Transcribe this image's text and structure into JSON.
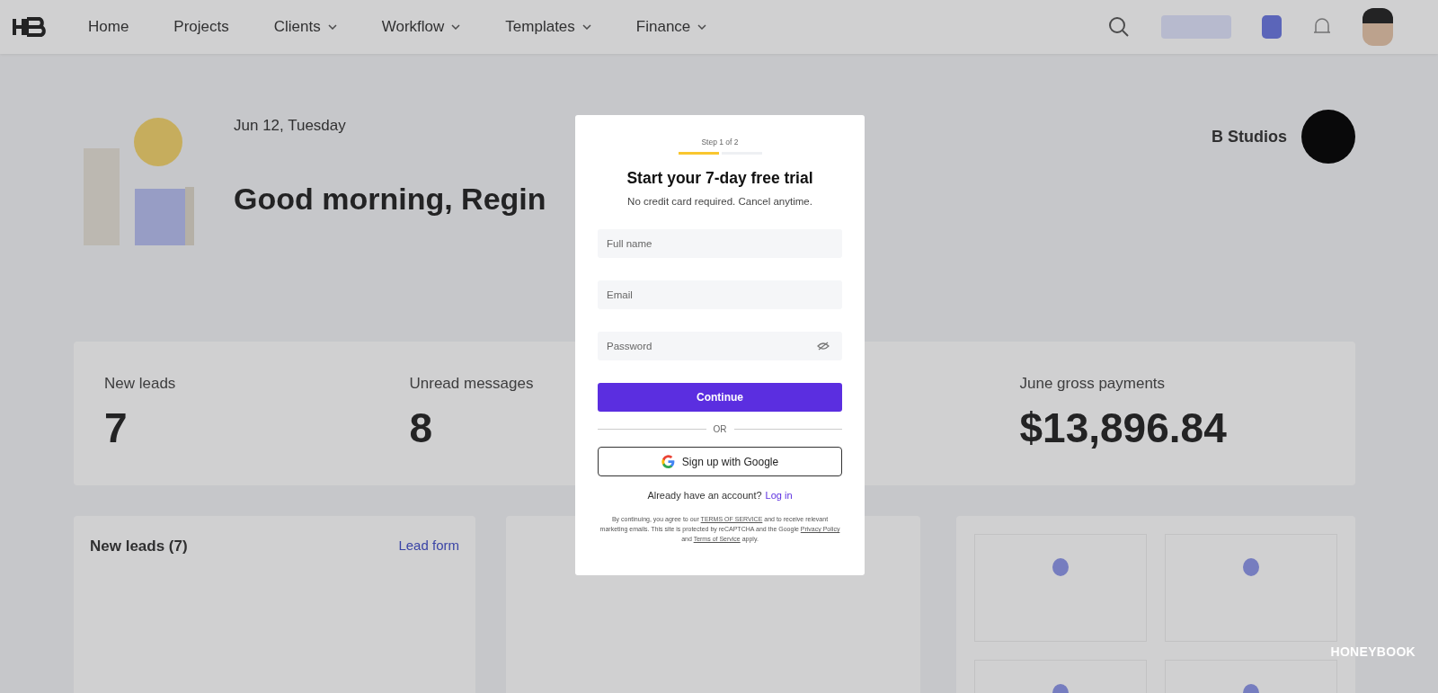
{
  "nav": {
    "items": [
      {
        "label": "Home",
        "dropdown": false
      },
      {
        "label": "Projects",
        "dropdown": false
      },
      {
        "label": "Clients",
        "dropdown": true
      },
      {
        "label": "Workflow",
        "dropdown": true
      },
      {
        "label": "Templates",
        "dropdown": true
      },
      {
        "label": "Finance",
        "dropdown": true
      }
    ]
  },
  "header": {
    "date": "Jun 12, Tuesday",
    "greeting": "Good morning, Regin",
    "company": "B Studios"
  },
  "stats": [
    {
      "label": "New leads",
      "value": "7"
    },
    {
      "label": "Unread messages",
      "value": "8"
    },
    {
      "label": "June gross payments",
      "value": "$13,896.84"
    }
  ],
  "leads_card": {
    "title": "New leads (7)",
    "action": "Lead form"
  },
  "signup_dialog": {
    "step": "Step 1 of 2",
    "steps": [
      {
        "active": true
      },
      {
        "active": false
      }
    ],
    "title": "Start your 7-day free trial",
    "subtitle": "No credit card required. Cancel anytime.",
    "fields": [
      {
        "placeholder": "Full name",
        "kind": "text"
      },
      {
        "placeholder": "Email",
        "kind": "email"
      },
      {
        "placeholder": "Password",
        "kind": "password"
      }
    ],
    "submit": "Continue",
    "divider": "OR",
    "google_button": "Sign up with Google",
    "login_prompt": "Already have an account?",
    "login_link": "Log in",
    "legal": [
      {
        "text": "By continuing, you agree to our ",
        "link": false
      },
      {
        "text": "TERMS OF SERVICE",
        "link": true
      },
      {
        "text": " and to receive relevant marketing emails. This site is protected by reCAPTCHA and the Google ",
        "link": false
      },
      {
        "text": "Privacy Policy",
        "link": true
      },
      {
        "text": " and ",
        "link": false
      },
      {
        "text": "Terms of Service",
        "link": true
      },
      {
        "text": " apply.",
        "link": false
      }
    ]
  },
  "brand_mark": "HONEYBOOK"
}
